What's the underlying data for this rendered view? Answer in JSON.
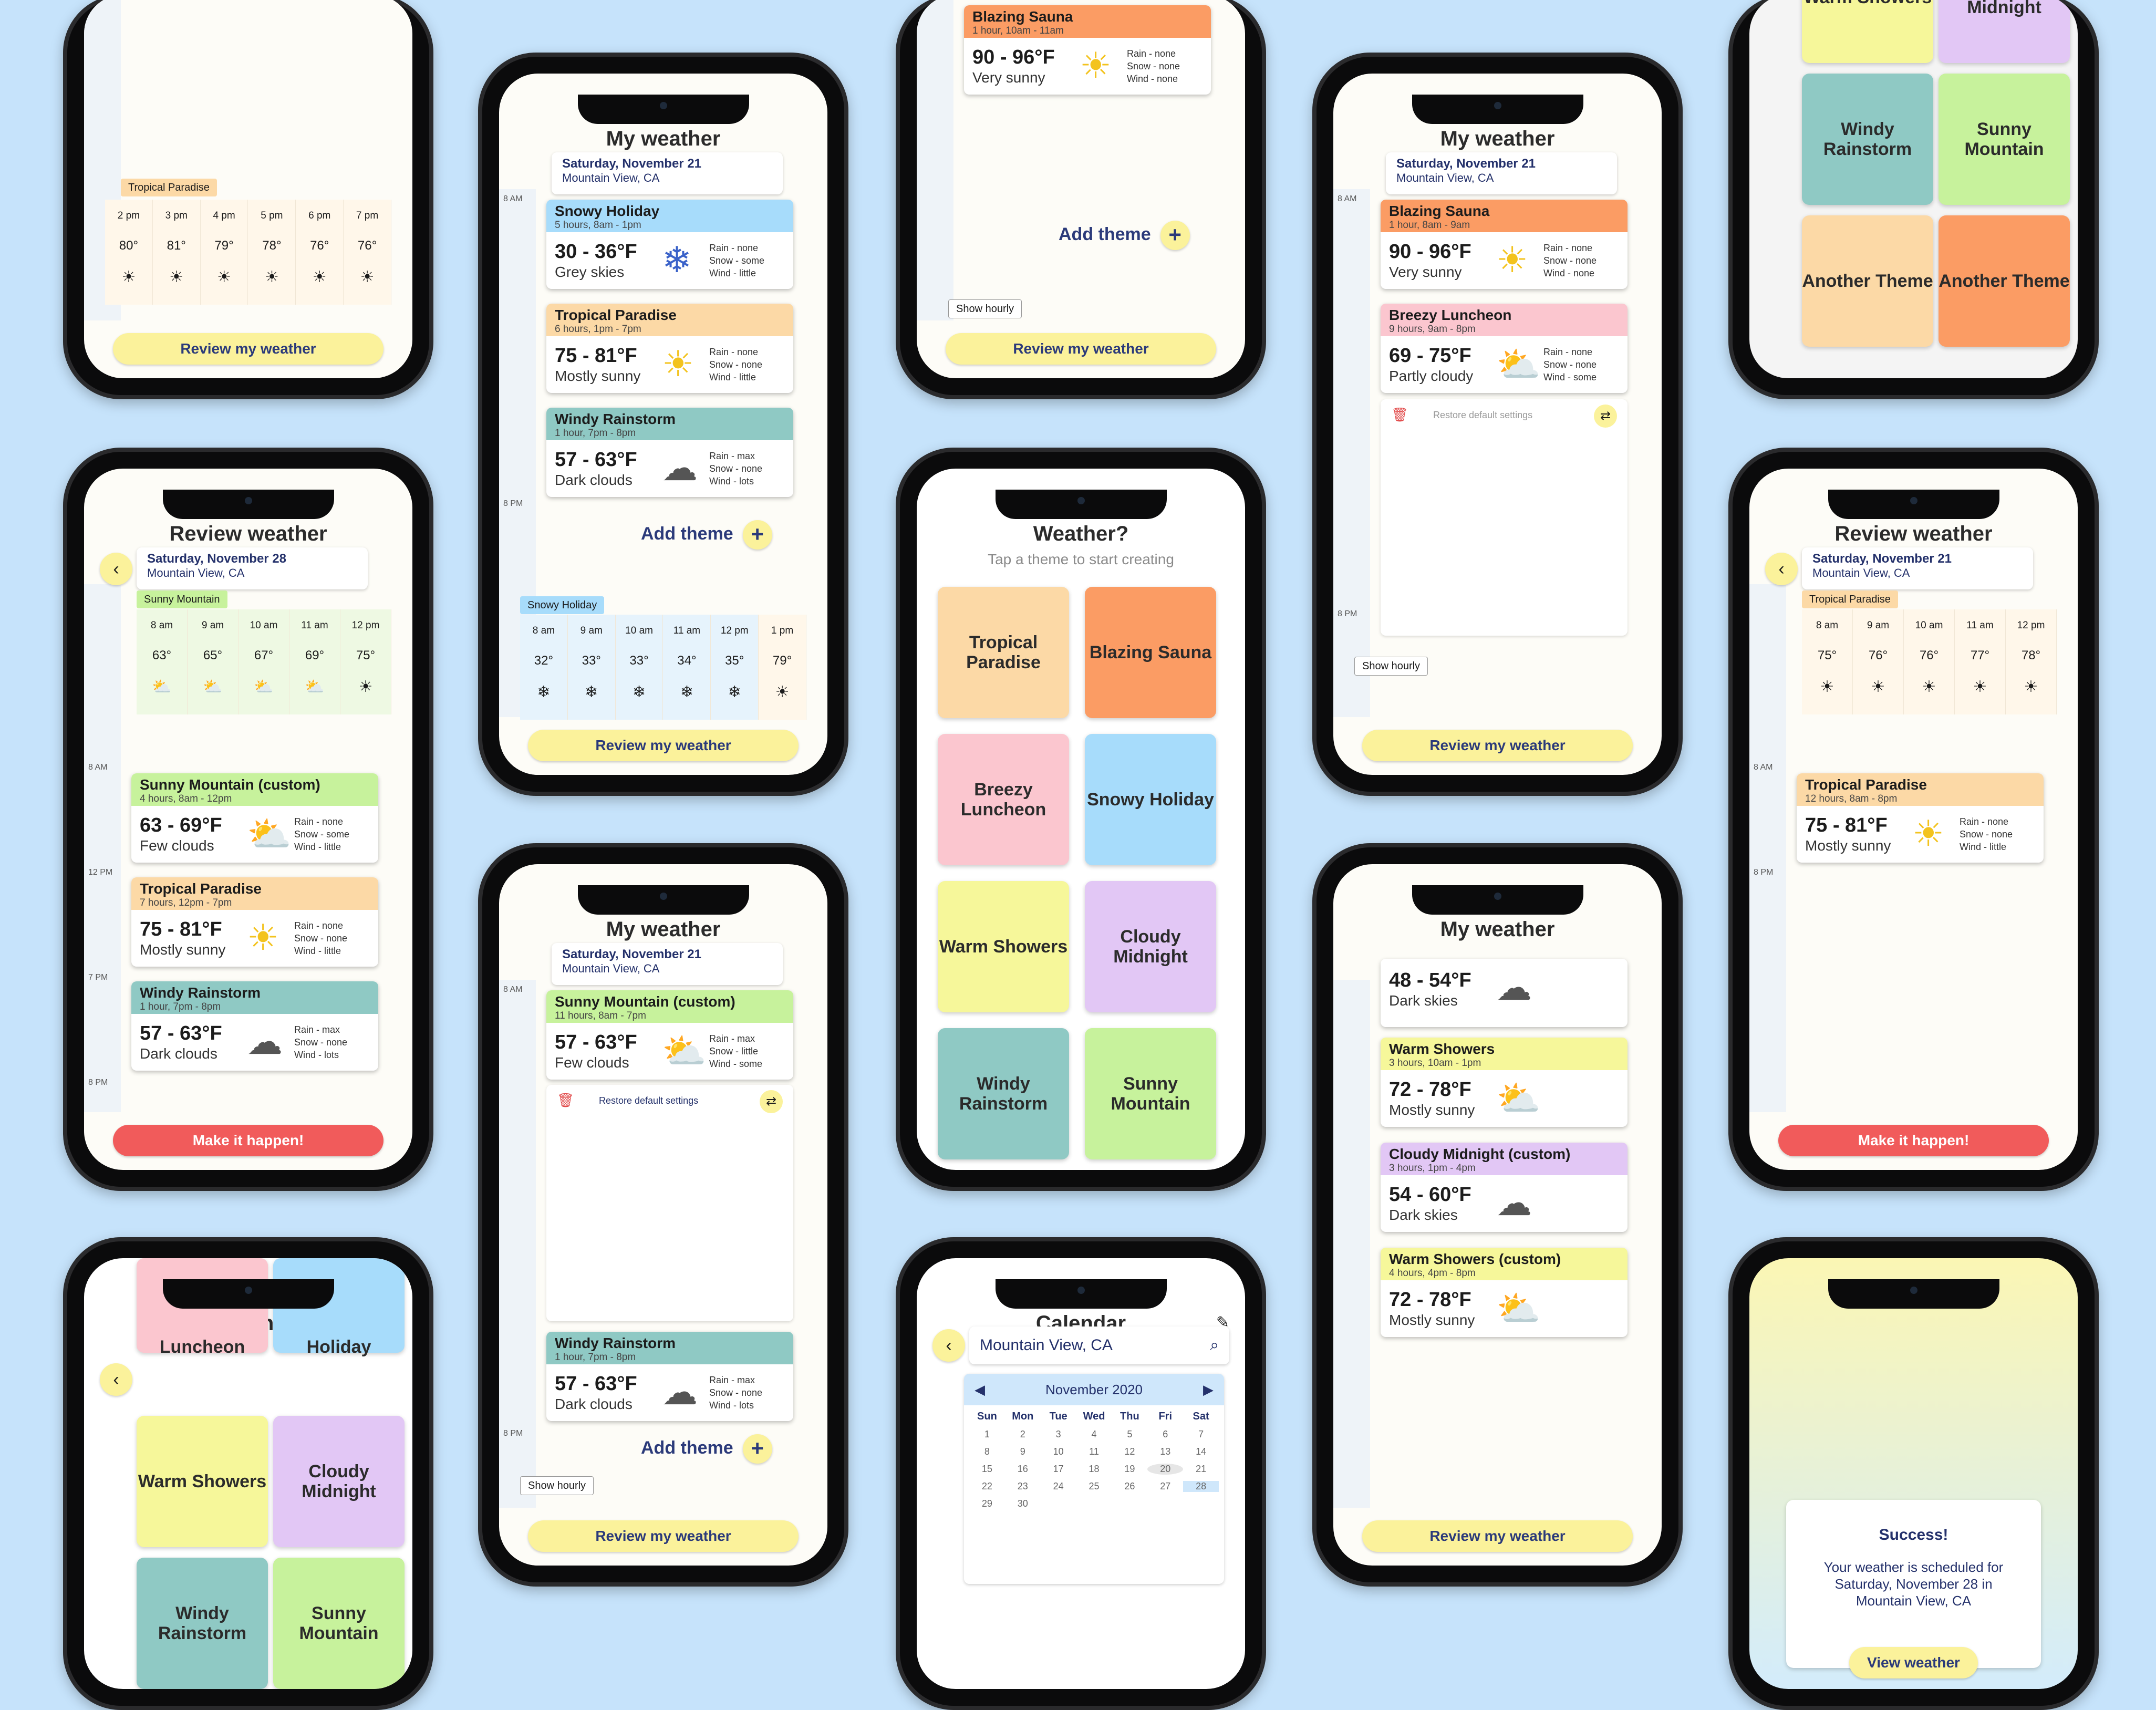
{
  "common": {
    "my_weather": "My weather",
    "review_weather": "Review weather",
    "review_button": "Review my weather",
    "make_it_happen": "Make it happen!",
    "add_theme": "Add theme",
    "show_hourly": "Show hourly",
    "restore": "Restore default settings",
    "date_nov21": "Saturday, November 21",
    "date_nov28": "Saturday, November 28",
    "location": "Mountain View, CA"
  },
  "weather_q": {
    "title": "Weather?",
    "subtitle": "Tap a theme to start creating",
    "tiles": [
      "Tropical Paradise",
      "Blazing Sauna",
      "Breezy Luncheon",
      "Snowy Holiday",
      "Warm Showers",
      "Cloudy Midnight",
      "Windy Rainstorm",
      "Sunny Mountain"
    ]
  },
  "switch_theme": {
    "title": "Switch theme",
    "tiles": [
      "Luncheon",
      "Holiday",
      "Warm Showers",
      "Cloudy Midnight",
      "Windy Rainstorm",
      "Sunny Mountain"
    ]
  },
  "theme_grid_top": {
    "tiles": [
      "Warm Showers",
      "Cloudy Midnight",
      "Windy Rainstorm",
      "Sunny Mountain",
      "Another Theme",
      "Another Theme"
    ]
  },
  "calendar": {
    "title": "Calendar",
    "search_value": "Mountain View, CA",
    "month": "November 2020",
    "dow": [
      "Sun",
      "Mon",
      "Tue",
      "Wed",
      "Thu",
      "Fri",
      "Sat"
    ],
    "weeks": [
      [
        "1",
        "2",
        "3",
        "4",
        "5",
        "6",
        "7"
      ],
      [
        "8",
        "9",
        "10",
        "11",
        "12",
        "13",
        "14"
      ],
      [
        "15",
        "16",
        "17",
        "18",
        "19",
        "20",
        "21"
      ],
      [
        "22",
        "23",
        "24",
        "25",
        "26",
        "27",
        "28"
      ],
      [
        "29",
        "30",
        "",
        "",
        "",
        "",
        ""
      ]
    ]
  },
  "success": {
    "title": "Success!",
    "message": "Your weather is scheduled for Saturday, November 28 in Mountain View, CA",
    "button": "View weather"
  },
  "cards": {
    "snowy_holiday": {
      "name": "Snowy Holiday",
      "time": "5 hours, 8am - 1pm",
      "temp": "30 - 36°F",
      "desc": "Grey skies",
      "rain": "Rain - none",
      "snow": "Snow - some",
      "wind": "Wind - little"
    },
    "tropical_1": {
      "name": "Tropical Paradise",
      "time": "6 hours, 1pm - 7pm",
      "temp": "75 - 81°F",
      "desc": "Mostly sunny",
      "rain": "Rain - none",
      "snow": "Snow - none",
      "wind": "Wind - little"
    },
    "windy_1": {
      "name": "Windy Rainstorm",
      "time": "1 hour, 7pm - 8pm",
      "temp": "57 - 63°F",
      "desc": "Dark clouds",
      "rain": "Rain - max",
      "snow": "Snow - none",
      "wind": "Wind - lots"
    },
    "blazing_1": {
      "name": "Blazing Sauna",
      "time": "1 hour, 8am - 9am",
      "temp": "90 - 96°F",
      "desc": "Very sunny",
      "rain": "Rain - none",
      "snow": "Snow - none",
      "wind": "Wind - none"
    },
    "breezy_1": {
      "name": "Breezy Luncheon",
      "time": "9 hours, 9am - 8pm",
      "temp": "69 - 75°F",
      "desc": "Partly cloudy",
      "rain": "Rain - none",
      "snow": "Snow - none",
      "wind": "Wind - some"
    },
    "sunny_mtn_1": {
      "name": "Sunny Mountain (custom)",
      "time": "4 hours, 8am - 12pm",
      "temp": "63 - 69°F",
      "desc": "Few clouds",
      "rain": "Rain - none",
      "snow": "Snow - some",
      "wind": "Wind - little"
    },
    "tropical_2": {
      "name": "Tropical Paradise",
      "time": "7 hours, 12pm - 7pm",
      "temp": "75 - 81°F",
      "desc": "Mostly sunny",
      "rain": "Rain - none",
      "snow": "Snow - none",
      "wind": "Wind - little"
    },
    "tropical_3": {
      "name": "Tropical Paradise",
      "time": "12 hours, 8am - 8pm",
      "temp": "75 - 81°F",
      "desc": "Mostly sunny",
      "rain": "Rain - none",
      "snow": "Snow - none",
      "wind": "Wind - little"
    },
    "sunny_mtn_2": {
      "name": "Sunny Mountain (custom)",
      "time": "11 hours, 8am - 7pm",
      "temp": "57 - 63°F",
      "desc": "Few clouds",
      "rain": "Rain - max",
      "snow": "Snow - little",
      "wind": "Wind - some"
    }
  },
  "hourly_top_left": {
    "tag": "Tropical Paradise",
    "hours": [
      "2 pm",
      "3 pm",
      "4 pm",
      "5 pm",
      "6 pm",
      "7 pm"
    ],
    "temps": [
      "80°",
      "81°",
      "79°",
      "78°",
      "76°",
      "76°"
    ]
  },
  "hourly_snowy": {
    "tag": "Snowy Holiday",
    "hours": [
      "8 am",
      "9 am",
      "10 am",
      "11 am",
      "12 pm",
      "1 pm"
    ],
    "temps": [
      "32°",
      "33°",
      "33°",
      "34°",
      "35°",
      "79°"
    ]
  },
  "hourly_sunny_mtn": {
    "tag": "Sunny Mountain",
    "hours": [
      "8 am",
      "9 am",
      "10 am",
      "11 am",
      "12 pm"
    ],
    "temps": [
      "63°",
      "65°",
      "67°",
      "69°",
      "75°"
    ]
  },
  "hourly_tropical_review": {
    "tag": "Tropical Paradise",
    "hours": [
      "8 am",
      "9 am",
      "10 am",
      "11 am",
      "12 pm"
    ],
    "temps": [
      "75°",
      "76°",
      "76°",
      "77°",
      "78°"
    ]
  },
  "time_labels": {
    "am8": "8 AM",
    "pm12": "12 PM",
    "pm7": "7 PM",
    "pm8": "8 PM"
  },
  "icons": [
    "sun-icon",
    "snowflake-icon",
    "cloud-icon",
    "rain-cloud-icon",
    "partly-cloudy-icon",
    "pencil-icon",
    "back-arrow-icon",
    "plus-icon",
    "search-icon",
    "swap-icon",
    "trash-icon",
    "drag-handle-icon"
  ],
  "colors": {
    "background": "#c6e3fb",
    "button_yellow": "#fbf29b",
    "button_red": "#f15b5b",
    "tropical": "#fcd9a6",
    "blazing": "#fb9c64",
    "breezy": "#fbc6cf",
    "snowy": "#a7dcfb",
    "warm": "#f6f79a",
    "cloudy": "#e2c7f5",
    "windy": "#8fc9c4",
    "sunny": "#c7f29c"
  }
}
